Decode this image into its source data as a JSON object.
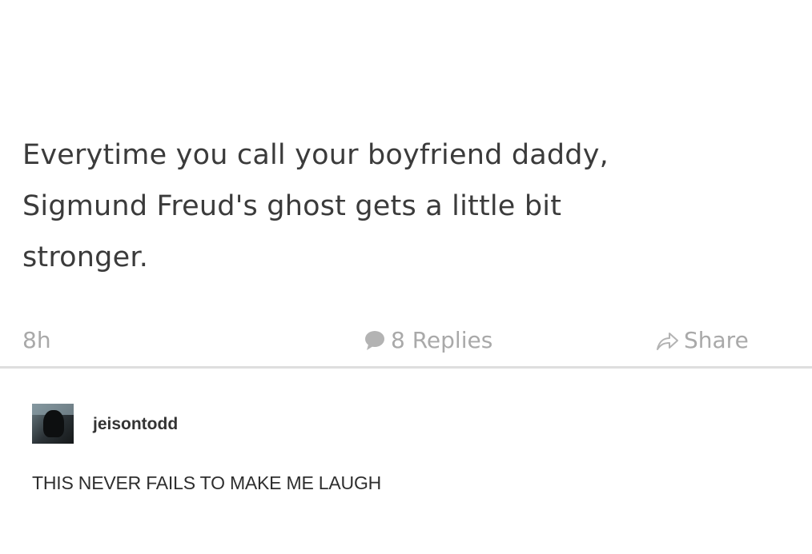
{
  "post": {
    "text_lines": [
      "Everytime you call your boyfriend daddy,",
      "Sigmund Freud's ghost gets a little bit",
      "stronger."
    ],
    "time": "8h",
    "replies_label": "8 Replies",
    "share_label": "Share",
    "icons": {
      "replies": "speech-bubble-icon",
      "share": "share-arrow-icon"
    },
    "meta_color": "#a9a9a9"
  },
  "comment": {
    "username": "jeisontodd",
    "text": "THIS NEVER FAILS TO MAKE ME LAUGH"
  }
}
